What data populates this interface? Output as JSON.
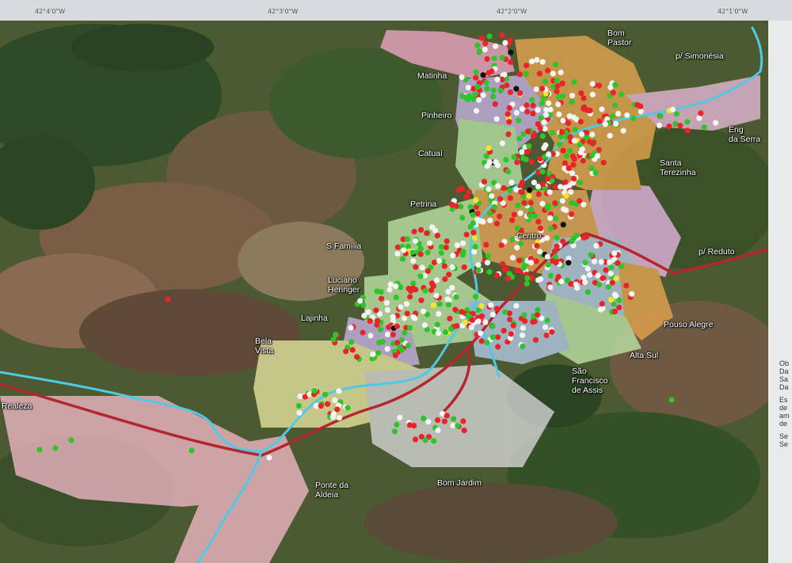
{
  "coords": [
    "42°4'0\"W",
    "42°3'0\"W",
    "42°2'0\"W",
    "42°1'0\"W"
  ],
  "places": {
    "bom_pastor": "Bom\nPastor",
    "simonesia": "p/ Simonésia",
    "matinha": "Matinha",
    "pinheiro": "Pinheiro",
    "catuai": "Catuaí",
    "eng_da_serra": "Eng\nda Serra",
    "santa_terezinha": "Santa\nTerezinha",
    "petrina": "Petrina",
    "s_familia": "S Família",
    "centro": "Centro",
    "p_reduto": "p/ Reduto",
    "luciano_heringer": "Luciano\nHeringer",
    "lajinha": "Lajinha",
    "bela_vista": "Bela\nVista",
    "pouso_alegre": "Pouso Alegre",
    "alta_sul": "Alta Sul",
    "sao_francisco": "São\nFrancisco\nde Assis",
    "realeza": "Realeza",
    "ponte_da_aldeia": "Ponte da\nAldeia",
    "bom_jardim": "Bom Jardim"
  },
  "side_text": [
    "Ob",
    "Da",
    "Sa",
    "Da",
    "",
    "Es",
    "de",
    "am",
    "de",
    "",
    "Se",
    "Se"
  ],
  "colors": {
    "dot_red": "#e8242a",
    "dot_green": "#2fc42a",
    "dot_white": "#f4f4f4",
    "dot_yellow": "#f2e52a",
    "dot_black": "#111111",
    "river": "#4fc9e6",
    "road": "#b3262d"
  }
}
